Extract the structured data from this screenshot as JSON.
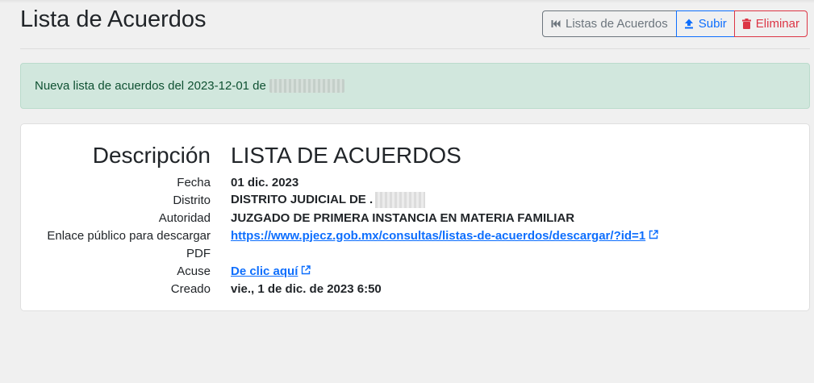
{
  "page": {
    "title": "Lista de Acuerdos"
  },
  "toolbar": {
    "back_label": "Listas de Acuerdos",
    "upload_label": "Subir",
    "delete_label": "Eliminar"
  },
  "alert": {
    "message": "Nueva lista de acuerdos del 2023-12-01 de"
  },
  "detail": {
    "heading_label": "Descripción",
    "heading_value": "LISTA DE ACUERDOS",
    "fields": [
      {
        "label": "Fecha",
        "value": "01 dic. 2023"
      },
      {
        "label": "Distrito",
        "value": "DISTRITO JUDICIAL DE ."
      },
      {
        "label": "Autoridad",
        "value": "JUZGADO DE PRIMERA INSTANCIA EN MATERIA FAMILIAR"
      },
      {
        "label": "Enlace público para descargar",
        "value": "https://www.pjecz.gob.mx/consultas/listas-de-acuerdos/descargar/?id=1"
      },
      {
        "label": "PDF",
        "value": ""
      },
      {
        "label": "Acuse",
        "value": "De clic aquí"
      },
      {
        "label": "Creado",
        "value": "vie., 1 de dic. de 2023 6:50"
      }
    ]
  },
  "colors": {
    "primary": "#0d6efd",
    "secondary": "#6c757d",
    "danger": "#dc3545",
    "success_bg": "#d1e7dd",
    "success_text": "#0f5132"
  },
  "icons": {
    "back": "skip-back-icon",
    "upload": "upload-icon",
    "delete": "trash-icon",
    "external": "external-link-icon"
  }
}
